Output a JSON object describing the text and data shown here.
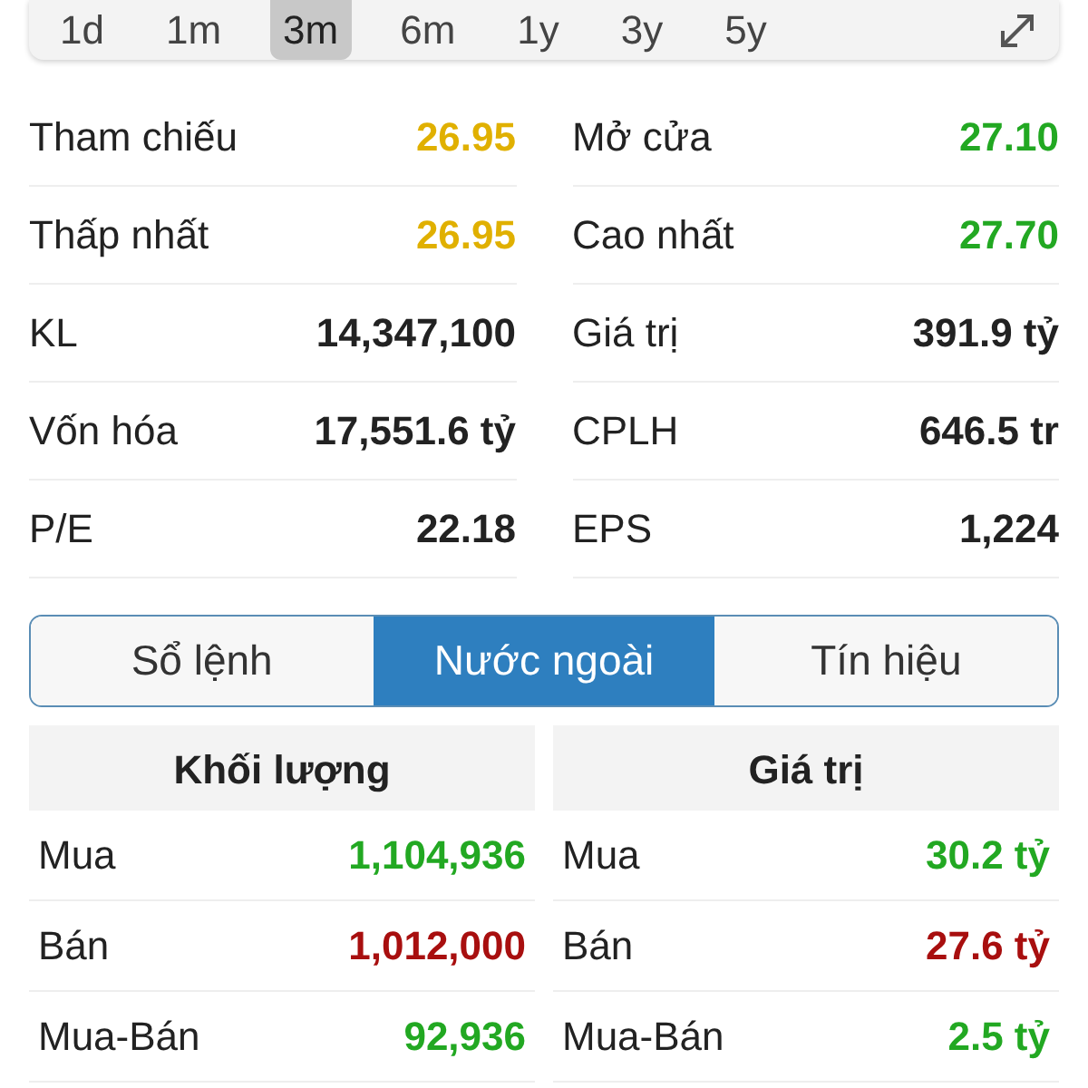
{
  "periods": [
    {
      "label": "1d",
      "selected": false
    },
    {
      "label": "1m",
      "selected": false
    },
    {
      "label": "3m",
      "selected": true
    },
    {
      "label": "6m",
      "selected": false
    },
    {
      "label": "1y",
      "selected": false
    },
    {
      "label": "3y",
      "selected": false
    },
    {
      "label": "5y",
      "selected": false
    }
  ],
  "stats": [
    {
      "label": "Tham chiếu",
      "value": "26.95",
      "color": "#e0b000"
    },
    {
      "label": "Mở cửa",
      "value": "27.10",
      "color": "#22a822"
    },
    {
      "label": "Thấp nhất",
      "value": "26.95",
      "color": "#e0b000"
    },
    {
      "label": "Cao nhất",
      "value": "27.70",
      "color": "#22a822"
    },
    {
      "label": "KL",
      "value": "14,347,100",
      "color": "#222222"
    },
    {
      "label": "Giá trị",
      "value": "391.9 tỷ",
      "color": "#222222"
    },
    {
      "label": "Vốn hóa",
      "value": "17,551.6 tỷ",
      "color": "#222222"
    },
    {
      "label": "CPLH",
      "value": "646.5 tr",
      "color": "#222222"
    },
    {
      "label": "P/E",
      "value": "22.18",
      "color": "#222222"
    },
    {
      "label": "EPS",
      "value": "1,224",
      "color": "#222222"
    }
  ],
  "tabs": [
    {
      "label": "Sổ lệnh",
      "selected": false
    },
    {
      "label": "Nước ngoài",
      "selected": true
    },
    {
      "label": "Tín hiệu",
      "selected": false
    }
  ],
  "foreign": [
    {
      "title": "Khối lượng",
      "rows": [
        {
          "label": "Mua",
          "value": "1,104,936",
          "color": "#22a822"
        },
        {
          "label": "Bán",
          "value": "1,012,000",
          "color": "#a80f0f"
        },
        {
          "label": "Mua-Bán",
          "value": "92,936",
          "color": "#22a822"
        }
      ]
    },
    {
      "title": "Giá trị",
      "rows": [
        {
          "label": "Mua",
          "value": "30.2 tỷ",
          "color": "#22a822"
        },
        {
          "label": "Bán",
          "value": "27.6 tỷ",
          "color": "#a80f0f"
        },
        {
          "label": "Mua-Bán",
          "value": "2.5 tỷ",
          "color": "#22a822"
        }
      ]
    }
  ]
}
